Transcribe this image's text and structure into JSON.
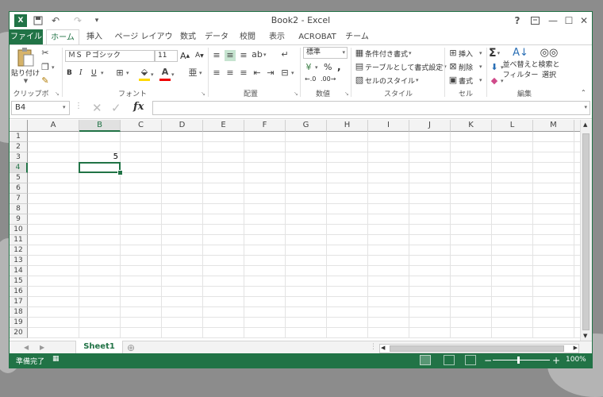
{
  "window": {
    "title": "Book2 - Excel",
    "help": "?",
    "min": "—",
    "max": "☐",
    "close": "✕",
    "qat": {
      "undo": "↶",
      "redo": "↷",
      "customize": "▾"
    }
  },
  "ribbon_tabs": [
    "ファイル",
    "ホーム",
    "挿入",
    "ページ レイアウト",
    "数式",
    "データ",
    "校閲",
    "表示",
    "ACROBAT",
    "チーム"
  ],
  "ribbon": {
    "clipboard": {
      "paste": "貼り付け",
      "label": "クリップボード"
    },
    "font": {
      "name": "ＭＳ Ｐゴシック",
      "size": "11",
      "grow": "A",
      "shrink": "A",
      "bold": "B",
      "italic": "I",
      "underline": "U",
      "label": "フォント"
    },
    "alignment": {
      "label": "配置"
    },
    "number": {
      "format": "標準",
      "percent": "%",
      "comma": ",",
      "label": "数値"
    },
    "styles": {
      "conditional": "条件付き書式",
      "table": "テーブルとして書式設定",
      "cell": "セルのスタイル",
      "label": "スタイル"
    },
    "cells": {
      "insert": "挿入",
      "delete": "削除",
      "format": "書式",
      "label": "セル"
    },
    "editing": {
      "sort_l1": "並べ替えと",
      "sort_l2": "フィルター",
      "find_l1": "検索と",
      "find_l2": "選択",
      "label": "編集"
    }
  },
  "formula_bar": {
    "name_box": "B4",
    "fx": "fx",
    "value": ""
  },
  "grid": {
    "columns": [
      "A",
      "B",
      "C",
      "D",
      "E",
      "F",
      "G",
      "H",
      "I",
      "J",
      "K",
      "L",
      "M"
    ],
    "rows": [
      "1",
      "2",
      "3",
      "4",
      "5",
      "6",
      "7",
      "8",
      "9",
      "10",
      "11",
      "12",
      "13",
      "14",
      "15",
      "16",
      "17",
      "18",
      "19",
      "20"
    ],
    "cells": {
      "B3": "5"
    },
    "selected": "B4"
  },
  "sheets": {
    "active": "Sheet1",
    "add": "⊕"
  },
  "status": {
    "ready": "準備完了",
    "zoom": "100%",
    "zoom_minus": "−",
    "zoom_plus": "+"
  },
  "colors": {
    "accent": "#217346"
  }
}
